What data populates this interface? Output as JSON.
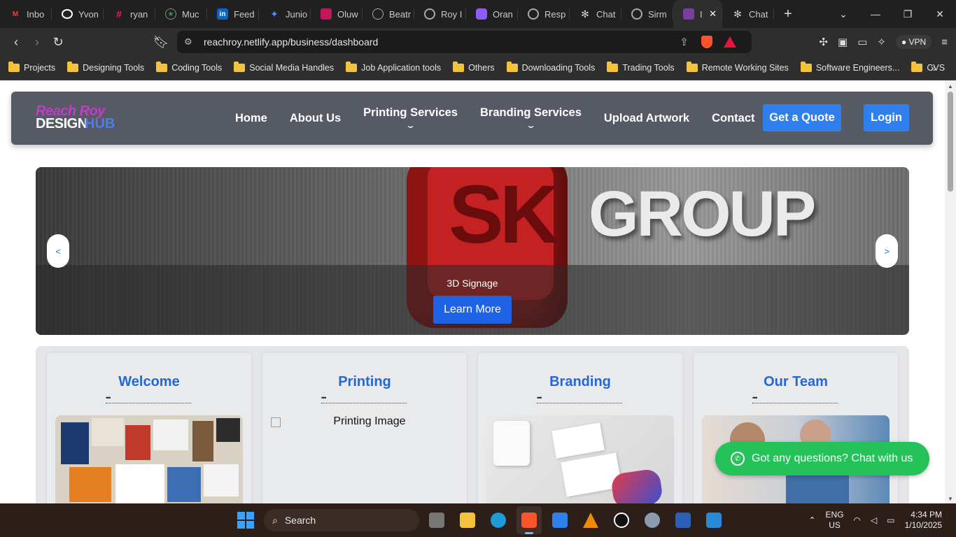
{
  "browser": {
    "tabs": [
      {
        "label": "Inbo",
        "icon": "gmail-icon",
        "color": "#ea4335"
      },
      {
        "label": "Yvon",
        "icon": "threads-icon",
        "color": "#ffffff"
      },
      {
        "label": "ryan",
        "icon": "slack-icon",
        "color": "#e01e5a"
      },
      {
        "label": "Muc",
        "icon": "star-icon",
        "color": "#2ea043"
      },
      {
        "label": "Feed",
        "icon": "linkedin-icon",
        "color": "#0a66c2"
      },
      {
        "label": "Junio",
        "icon": "sparkle-icon",
        "color": "#4a8cff"
      },
      {
        "label": "Oluw",
        "icon": "avatar-icon",
        "color": "#c2185b"
      },
      {
        "label": "Beatr",
        "icon": "circle-icon",
        "color": "#5a5a5a"
      },
      {
        "label": "Roy I",
        "icon": "globe-icon",
        "color": "#6a6a6a"
      },
      {
        "label": "Oran",
        "icon": "copilot-icon",
        "color": "#8b5cf6"
      },
      {
        "label": "Resp",
        "icon": "globe-icon",
        "color": "#6a6a6a"
      },
      {
        "label": "Chat",
        "icon": "openai-icon",
        "color": "#444444"
      },
      {
        "label": "Sirm",
        "icon": "globe-icon",
        "color": "#6a6a6a"
      },
      {
        "label": "I",
        "icon": "site-icon",
        "color": "#7b3fa0"
      },
      {
        "label": "Chat",
        "icon": "openai-icon",
        "color": "#444444"
      }
    ],
    "url": "reachroy.netlify.app/business/dashboard",
    "vpn_label": "VPN",
    "bookmarks": [
      "Projects",
      "Designing Tools",
      "Coding Tools",
      "Social Media Handles",
      "Job Application tools",
      "Others",
      "Downloading Tools",
      "Trading Tools",
      "Remote Working Sites",
      "Software Engineers...",
      "CVS"
    ]
  },
  "site": {
    "logo": {
      "line1": "Reach Roy",
      "line2": "DESIGN",
      "line3": "HUB"
    },
    "menu": [
      "Home",
      "About Us",
      "Printing Services",
      "Branding Services",
      "Upload Artwork",
      "Contact"
    ],
    "quote_button": "Get a Quote",
    "login_button": "Login",
    "hero": {
      "sign_letters": "SK",
      "sign_word": "GROUP",
      "caption": "3D Signage",
      "cta": "Learn More",
      "prev": "<",
      "next": ">"
    },
    "cards": [
      {
        "title": "Welcome"
      },
      {
        "title": "Printing",
        "img_alt": "Printing Image"
      },
      {
        "title": "Branding"
      },
      {
        "title": "Our Team"
      }
    ],
    "chat_label": "Got any questions? Chat with us",
    "accent_color": "#2f80ed",
    "chat_color": "#25c25a"
  },
  "taskbar": {
    "search": "Search",
    "lang_line1": "ENG",
    "lang_line2": "US",
    "time": "4:34 PM",
    "date": "1/10/2025"
  }
}
